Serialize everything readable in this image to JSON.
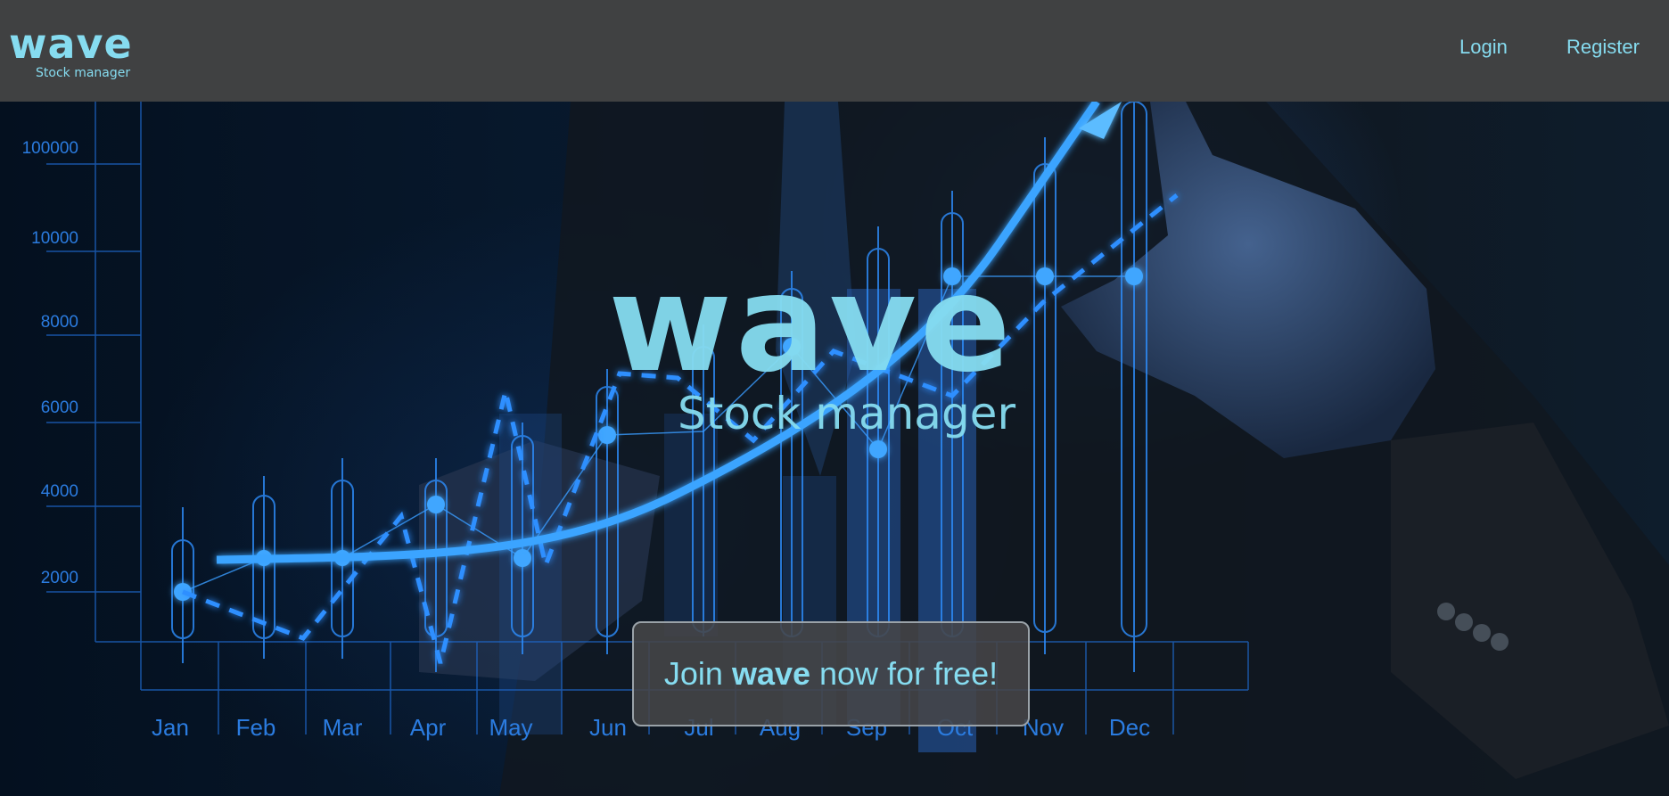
{
  "navbar": {
    "logo_text": "wave",
    "logo_subtitle": "Stock manager",
    "login_label": "Login",
    "register_label": "Register"
  },
  "hero": {
    "title": "wave",
    "subtitle": "Stock manager",
    "cta_prefix": "Join",
    "cta_brand": "wave",
    "cta_suffix": "now for free!"
  },
  "background_chart": {
    "y_ticks": [
      "100000",
      "10000",
      "8000",
      "6000",
      "4000",
      "2000"
    ],
    "x_ticks": [
      "Jan",
      "Feb",
      "Mar",
      "Apr",
      "May",
      "Jun",
      "Jul",
      "Aug",
      "Sep",
      "Oct",
      "Nov",
      "Dec"
    ]
  },
  "colors": {
    "navbar_bg": "#404142",
    "accent": "#86dcf0",
    "glow_blue": "#2e8fff",
    "cta_bg": "#464648"
  }
}
